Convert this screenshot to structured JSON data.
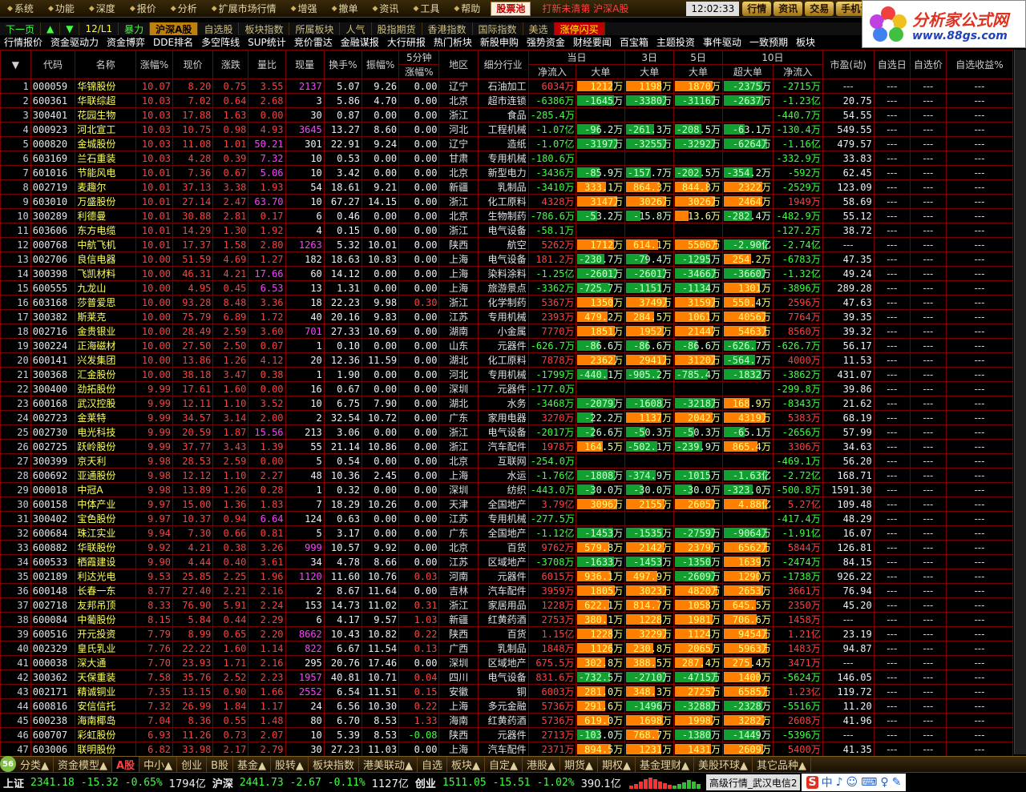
{
  "menubar": {
    "items": [
      "系统",
      "功能",
      "深度",
      "报价",
      "分析",
      "扩展市场行情",
      "增强",
      "撤单",
      "资讯",
      "工具",
      "帮助"
    ],
    "pool_label": "股票池",
    "ticker": "打新未清第  沪深A股",
    "clock": "12:02:33",
    "right_buttons": [
      "行情",
      "资讯",
      "交易",
      "手机证"
    ]
  },
  "logo": {
    "title": "分析家公式网",
    "url": "www.88gs.com"
  },
  "tabbar1": {
    "nav": [
      "下一页",
      "▲",
      "▼",
      "12/L1",
      "暴力"
    ],
    "active": "沪深A股",
    "items": [
      "自选股",
      "板块指数",
      "所属板块",
      "人气",
      "股指期货",
      "香港指数",
      "国际指数",
      "美选"
    ],
    "red": "涨停闪买"
  },
  "tabbar2": {
    "items": [
      "行情报价",
      "资金驱动力",
      "资金博弈",
      "DDE排名",
      "多空阵线",
      "SUP统计",
      "竞价雷达",
      "金融谋报",
      "大行研报",
      "热门析块",
      "新股申购",
      "强势资金",
      "财经要闻",
      "百宝箱",
      "主题投资",
      "事件驱动",
      "一致预期",
      "板块"
    ]
  },
  "table": {
    "group_headers": {
      "five_min": "5分钟",
      "today": "当日",
      "d3": "3日",
      "d5": "5日",
      "d10": "10日"
    },
    "headers": [
      "",
      "代码",
      "名称",
      "涨幅%",
      "现价",
      "涨跌",
      "量比",
      "现量",
      "换手%",
      "振幅%",
      "涨幅%",
      "地区",
      "细分行业",
      "净流入",
      "大单",
      "大单",
      "大单",
      "超大单",
      "净流入",
      "市盈(动)",
      "自选日",
      "自选价",
      "自选收益%"
    ],
    "sort_icon": "▼",
    "rows": [
      [
        "1",
        "000059",
        "华锦股份",
        "10.07",
        "8.20",
        "0.75",
        "3.55",
        "2137",
        "5.07",
        "9.26",
        "0.00",
        "辽宁",
        "石油加工",
        "6034万",
        "1212万",
        "1198万",
        "1870万",
        "-2375万",
        "-2715万",
        "---"
      ],
      [
        "2",
        "600361",
        "华联综超",
        "10.03",
        "7.02",
        "0.64",
        "2.68",
        "3",
        "5.86",
        "4.70",
        "0.00",
        "北京",
        "超市连锁",
        "-6386万",
        "-1645万",
        "-3380万",
        "-3116万",
        "-2637万",
        "-1.23亿",
        "20.75"
      ],
      [
        "3",
        "300401",
        "花园生物",
        "10.03",
        "17.88",
        "1.63",
        "0.00",
        "30",
        "0.87",
        "0.00",
        "0.00",
        "浙江",
        "食品",
        "-285.4万",
        "",
        "",
        "",
        "",
        "-440.7万",
        "54.55"
      ],
      [
        "4",
        "000923",
        "河北宣工",
        "10.03",
        "10.75",
        "0.98",
        "4.93",
        "3645",
        "13.27",
        "8.60",
        "0.00",
        "河北",
        "工程机械",
        "-1.07亿",
        "-96.2万",
        "-261.3万",
        "-208.5万",
        "-63.1万",
        "-130.4万",
        "549.55"
      ],
      [
        "5",
        "000820",
        "金城股份",
        "10.03",
        "11.08",
        "1.01",
        "50.21",
        "301",
        "22.91",
        "9.24",
        "0.00",
        "辽宁",
        "造纸",
        "-1.07亿",
        "-3197万",
        "-3255万",
        "-3292万",
        "-6264万",
        "-1.16亿",
        "479.57"
      ],
      [
        "6",
        "603169",
        "兰石重装",
        "10.03",
        "4.28",
        "0.39",
        "7.32",
        "10",
        "0.53",
        "0.00",
        "0.00",
        "甘肃",
        "专用机械",
        "-180.6万",
        "",
        "",
        "",
        "",
        "-332.9万",
        "33.83"
      ],
      [
        "7",
        "601016",
        "节能风电",
        "10.01",
        "7.36",
        "0.67",
        "5.06",
        "10",
        "3.42",
        "0.00",
        "0.00",
        "北京",
        "新型电力",
        "-3436万",
        "-85.9万",
        "-157.7万",
        "-202.5万",
        "-354.2万",
        "-592万",
        "62.45"
      ],
      [
        "8",
        "002719",
        "麦趣尔",
        "10.01",
        "37.13",
        "3.38",
        "1.93",
        "54",
        "18.61",
        "9.21",
        "0.00",
        "新疆",
        "乳制品",
        "-3410万",
        "333.1万",
        "864.3万",
        "844.8万",
        "2322万",
        "-2529万",
        "123.09"
      ],
      [
        "9",
        "603010",
        "万盛股份",
        "10.01",
        "27.14",
        "2.47",
        "63.70",
        "10",
        "67.27",
        "14.15",
        "0.00",
        "浙江",
        "化工原料",
        "4328万",
        "3147万",
        "3026万",
        "3026万",
        "2464万",
        "1949万",
        "58.69"
      ],
      [
        "10",
        "300289",
        "利德曼",
        "10.01",
        "30.88",
        "2.81",
        "0.17",
        "6",
        "0.46",
        "0.00",
        "0.00",
        "北京",
        "生物制药",
        "-786.6万",
        "-53.2万",
        "-15.8万",
        "13.6万",
        "-282.4万",
        "-482.9万",
        "55.12"
      ],
      [
        "11",
        "603606",
        "东方电缆",
        "10.01",
        "14.29",
        "1.30",
        "1.92",
        "4",
        "0.15",
        "0.00",
        "0.00",
        "浙江",
        "电气设备",
        "-58.1万",
        "",
        "",
        "",
        "",
        "-127.2万",
        "38.72"
      ],
      [
        "12",
        "000768",
        "中航飞机",
        "10.01",
        "17.37",
        "1.58",
        "2.80",
        "1263",
        "5.32",
        "10.01",
        "0.00",
        "陕西",
        "航空",
        "5262万",
        "1712万",
        "614.1万",
        "5506万",
        "-2.90亿",
        "-2.74亿",
        "---"
      ],
      [
        "13",
        "002706",
        "良信电器",
        "10.00",
        "51.59",
        "4.69",
        "1.27",
        "182",
        "18.63",
        "10.83",
        "0.00",
        "上海",
        "电气设备",
        "181.2万",
        "-230.7万",
        "-79.4万",
        "-1295万",
        "254.2万",
        "-6783万",
        "47.35"
      ],
      [
        "14",
        "300398",
        "飞凯材料",
        "10.00",
        "46.31",
        "4.21",
        "17.66",
        "60",
        "14.12",
        "0.00",
        "0.00",
        "上海",
        "染料涂料",
        "-1.25亿",
        "-2601万",
        "-2601万",
        "-3466万",
        "-3660万",
        "-1.32亿",
        "49.24"
      ],
      [
        "15",
        "600555",
        "九龙山",
        "10.00",
        "4.95",
        "0.45",
        "6.53",
        "13",
        "1.31",
        "0.00",
        "0.00",
        "上海",
        "旅游景点",
        "-3362万",
        "-725.7万",
        "-1151万",
        "-1134万",
        "1301万",
        "-3896万",
        "289.28"
      ],
      [
        "16",
        "603168",
        "莎普爱思",
        "10.00",
        "93.28",
        "8.48",
        "3.36",
        "18",
        "22.23",
        "9.98",
        "0.30",
        "浙江",
        "化学制药",
        "5367万",
        "1350万",
        "3749万",
        "3159万",
        "550.4万",
        "2596万",
        "47.63"
      ],
      [
        "17",
        "300382",
        "斯莱克",
        "10.00",
        "75.79",
        "6.89",
        "1.72",
        "40",
        "20.16",
        "9.83",
        "0.00",
        "江苏",
        "专用机械",
        "2393万",
        "479.2万",
        "284.5万",
        "1061万",
        "4056万",
        "7764万",
        "39.35"
      ],
      [
        "18",
        "002716",
        "金贵银业",
        "10.00",
        "28.49",
        "2.59",
        "3.60",
        "701",
        "27.33",
        "10.69",
        "0.00",
        "湖南",
        "小金属",
        "7770万",
        "1851万",
        "1952万",
        "2144万",
        "5463万",
        "8560万",
        "39.32"
      ],
      [
        "19",
        "300224",
        "正海磁材",
        "10.00",
        "27.50",
        "2.50",
        "0.07",
        "1",
        "0.10",
        "0.00",
        "0.00",
        "山东",
        "元器件",
        "-626.7万",
        "-86.6万",
        "-86.6万",
        "-86.6万",
        "-626.7万",
        "-626.7万",
        "56.17"
      ],
      [
        "20",
        "600141",
        "兴发集团",
        "10.00",
        "13.86",
        "1.26",
        "4.12",
        "20",
        "12.36",
        "11.59",
        "0.00",
        "湖北",
        "化工原料",
        "7878万",
        "2362万",
        "2941万",
        "3120万",
        "-564.7万",
        "4000万",
        "11.53"
      ],
      [
        "21",
        "300368",
        "汇金股份",
        "10.00",
        "38.18",
        "3.47",
        "0.38",
        "1",
        "1.90",
        "0.00",
        "0.00",
        "河北",
        "专用机械",
        "-1799万",
        "-440.1万",
        "-905.2万",
        "-785.4万",
        "-1832万",
        "-3862万",
        "431.07"
      ],
      [
        "22",
        "300400",
        "劲拓股份",
        "9.99",
        "17.61",
        "1.60",
        "0.00",
        "16",
        "0.67",
        "0.00",
        "0.00",
        "深圳",
        "元器件",
        "-177.0万",
        "",
        "",
        "",
        "",
        "-299.8万",
        "39.86"
      ],
      [
        "23",
        "600168",
        "武汉控股",
        "9.99",
        "12.11",
        "1.10",
        "3.52",
        "10",
        "6.75",
        "7.90",
        "0.00",
        "湖北",
        "水务",
        "-3468万",
        "-2079万",
        "-1608万",
        "-3218万",
        "168.9万",
        "-8343万",
        "21.62"
      ],
      [
        "24",
        "002723",
        "金莱特",
        "9.99",
        "34.57",
        "3.14",
        "2.00",
        "2",
        "32.54",
        "10.72",
        "0.00",
        "广东",
        "家用电器",
        "3270万",
        "-22.2万",
        "1137万",
        "2042万",
        "4319万",
        "5383万",
        "68.19"
      ],
      [
        "25",
        "002730",
        "电光科技",
        "9.99",
        "20.59",
        "1.87",
        "15.56",
        "213",
        "3.06",
        "0.00",
        "0.00",
        "浙江",
        "电气设备",
        "-2017万",
        "-26.6万",
        "-50.3万",
        "-50.3万",
        "-65.1万",
        "-2656万",
        "57.99"
      ],
      [
        "26",
        "002725",
        "跃岭股份",
        "9.99",
        "37.77",
        "3.43",
        "1.39",
        "55",
        "21.14",
        "10.86",
        "0.00",
        "浙江",
        "汽车配件",
        "1978万",
        "164.5万",
        "-502.1万",
        "-239.9万",
        "865.4万",
        "3306万",
        "34.63"
      ],
      [
        "27",
        "300399",
        "京天利",
        "9.98",
        "28.53",
        "2.59",
        "0.00",
        "5",
        "0.54",
        "0.00",
        "0.00",
        "北京",
        "互联网",
        "-254.0万",
        "",
        "",
        "",
        "",
        "-469.1万",
        "56.20"
      ],
      [
        "28",
        "600692",
        "亚通股份",
        "9.98",
        "12.12",
        "1.10",
        "2.27",
        "48",
        "10.36",
        "2.45",
        "0.00",
        "上海",
        "水运",
        "-1.76亿",
        "-1808万",
        "-374.9万",
        "-1015万",
        "-1.63亿",
        "-2.72亿",
        "168.71"
      ],
      [
        "29",
        "000018",
        "中冠A",
        "9.98",
        "13.89",
        "1.26",
        "0.28",
        "1",
        "0.32",
        "0.00",
        "0.00",
        "深圳",
        "纺织",
        "-443.0万",
        "-30.0万",
        "-30.0万",
        "-30.0万",
        "-323.0万",
        "-500.8万",
        "1591.30"
      ],
      [
        "30",
        "600158",
        "中体产业",
        "9.97",
        "15.00",
        "1.36",
        "1.83",
        "7",
        "18.29",
        "10.26",
        "0.00",
        "天津",
        "全国地产",
        "3.79亿",
        "3096万",
        "2155万",
        "2605万",
        "4.88亿",
        "5.27亿",
        "109.48"
      ],
      [
        "31",
        "300402",
        "宝色股份",
        "9.97",
        "10.37",
        "0.94",
        "6.64",
        "124",
        "0.63",
        "0.00",
        "0.00",
        "江苏",
        "专用机械",
        "-277.5万",
        "",
        "",
        "",
        "",
        "-417.4万",
        "48.29"
      ],
      [
        "32",
        "600684",
        "珠江实业",
        "9.94",
        "7.30",
        "0.66",
        "0.81",
        "5",
        "3.17",
        "0.00",
        "0.00",
        "广东",
        "全国地产",
        "-1.12亿",
        "-1453万",
        "-1535万",
        "-2759万",
        "-9064万",
        "-1.91亿",
        "16.07"
      ],
      [
        "33",
        "600882",
        "华联股份",
        "9.92",
        "4.21",
        "0.38",
        "3.26",
        "999",
        "10.57",
        "9.92",
        "0.00",
        "北京",
        "百货",
        "9762万",
        "579.8万",
        "2142万",
        "2379万",
        "6562万",
        "5844万",
        "126.81"
      ],
      [
        "34",
        "600533",
        "栖霞建设",
        "9.90",
        "4.44",
        "0.40",
        "3.61",
        "34",
        "4.78",
        "8.66",
        "0.00",
        "江苏",
        "区域地产",
        "-3708万",
        "-1633万",
        "-1453万",
        "-1350万",
        "1639万",
        "-2474万",
        "84.15"
      ],
      [
        "35",
        "002189",
        "利达光电",
        "9.53",
        "25.85",
        "2.25",
        "1.96",
        "1120",
        "11.60",
        "10.76",
        "0.03",
        "河南",
        "元器件",
        "6015万",
        "936.1万",
        "497.9万",
        "-2609万",
        "1290万",
        "-1738万",
        "926.22"
      ],
      [
        "36",
        "600148",
        "长春一东",
        "8.77",
        "27.40",
        "2.21",
        "2.16",
        "2",
        "8.67",
        "11.64",
        "0.00",
        "吉林",
        "汽车配件",
        "3959万",
        "1805万",
        "3023万",
        "4820万",
        "2653万",
        "3661万",
        "76.94"
      ],
      [
        "37",
        "002718",
        "友邦吊顶",
        "8.33",
        "76.90",
        "5.91",
        "2.24",
        "153",
        "14.73",
        "11.02",
        "0.31",
        "浙江",
        "家居用品",
        "1228万",
        "622.1万",
        "814.7万",
        "1058万",
        "645.5万",
        "2350万",
        "45.20"
      ],
      [
        "38",
        "600084",
        "中葡股份",
        "8.15",
        "5.84",
        "0.44",
        "2.29",
        "6",
        "4.17",
        "9.57",
        "1.03",
        "新疆",
        "红黄药酒",
        "2753万",
        "380.1万",
        "1228万",
        "1981万",
        "706.6万",
        "1458万",
        "---"
      ],
      [
        "39",
        "600516",
        "开元投资",
        "7.79",
        "8.99",
        "0.65",
        "2.20",
        "8662",
        "10.43",
        "10.82",
        "0.22",
        "陕西",
        "百货",
        "1.15亿",
        "1228万",
        "3229万",
        "1124万",
        "9454万",
        "1.21亿",
        "23.19"
      ],
      [
        "40",
        "002329",
        "皇氏乳业",
        "7.76",
        "22.22",
        "1.60",
        "1.14",
        "822",
        "6.67",
        "11.54",
        "0.13",
        "广西",
        "乳制品",
        "1848万",
        "1126万",
        "230.8万",
        "2065万",
        "5963万",
        "1483万",
        "94.87"
      ],
      [
        "41",
        "000038",
        "深大通",
        "7.70",
        "23.93",
        "1.71",
        "2.16",
        "295",
        "20.76",
        "17.46",
        "0.00",
        "深圳",
        "区域地产",
        "675.5万",
        "302.8万",
        "388.5万",
        "287.4万",
        "275.4万",
        "3471万",
        "---"
      ],
      [
        "42",
        "300362",
        "天保重装",
        "7.58",
        "35.76",
        "2.52",
        "2.23",
        "1957",
        "40.81",
        "10.71",
        "0.04",
        "四川",
        "电气设备",
        "831.6万",
        "-732.5万",
        "-2710万",
        "-4715万",
        "1400万",
        "-5624万",
        "146.05"
      ],
      [
        "43",
        "002171",
        "精诚铜业",
        "7.35",
        "13.15",
        "0.90",
        "1.66",
        "2552",
        "6.54",
        "11.51",
        "0.15",
        "安徽",
        "铜",
        "6003万",
        "281.0万",
        "348.3万",
        "2725万",
        "6585万",
        "1.23亿",
        "119.72"
      ],
      [
        "44",
        "600816",
        "安信信托",
        "7.32",
        "26.99",
        "1.84",
        "1.17",
        "24",
        "6.56",
        "10.30",
        "0.22",
        "上海",
        "多元金融",
        "5736万",
        "291.6万",
        "-1496万",
        "-3288万",
        "-2328万",
        "-5516万",
        "11.20"
      ],
      [
        "45",
        "600238",
        "海南椰岛",
        "7.04",
        "8.36",
        "0.55",
        "1.48",
        "80",
        "6.70",
        "8.53",
        "1.33",
        "海南",
        "红黄药酒",
        "5736万",
        "619.0万",
        "1698万",
        "1998万",
        "3282万",
        "2608万",
        "41.96"
      ],
      [
        "46",
        "600707",
        "彩虹股份",
        "6.93",
        "11.26",
        "0.73",
        "2.07",
        "10",
        "5.39",
        "8.53",
        "-0.08",
        "陕西",
        "元器件",
        "2713万",
        "-103.0万",
        "768.7万",
        "-1380万",
        "-1449万",
        "-5396万",
        "---"
      ],
      [
        "47",
        "603006",
        "联明股份",
        "6.82",
        "33.98",
        "2.17",
        "2.79",
        "30",
        "27.23",
        "11.03",
        "0.00",
        "上海",
        "汽车配件",
        "2371万",
        "894.5万",
        "1231万",
        "1431万",
        "2609万",
        "5400万",
        "41.35"
      ]
    ]
  },
  "bottomtabs": {
    "badge": "56",
    "items": [
      "分类▲",
      "资金模型▲",
      "A股",
      "中小▲",
      "创业",
      "B股",
      "基金▲",
      "股转▲",
      "板块指数",
      "港美联动▲",
      "自选",
      "板块▲",
      "自定▲",
      "港股▲",
      "期货▲",
      "期权▲",
      "基金理财▲",
      "美股环球▲",
      "其它品种▲"
    ],
    "active_index": 2
  },
  "statusbar": {
    "sh_label": "上证",
    "sh_index": "2341.18",
    "sh_chg": "-15.32",
    "sh_pct": "-0.65%",
    "sh_amt": "1794亿",
    "hs_label": "沪深",
    "hs_index": "2441.73",
    "hs_chg": "-2.67",
    "hs_pct": "-0.11%",
    "hs_amt": "1127亿",
    "cy_label": "创业",
    "cy_index": "1511.05",
    "cy_chg": "-15.51",
    "cy_pct": "-1.02%",
    "cy_amt": "390.1亿",
    "server": "高级行情_武汉电信2",
    "tray": [
      "S",
      "中",
      "♪",
      "☺",
      "⌨",
      "♀",
      "✎"
    ]
  },
  "colors": {
    "up": "#ff4040",
    "down": "#40ff40",
    "inflow_bar": "#ff8000",
    "outflow_bar": "#10a030",
    "grid": "#7a0000"
  }
}
